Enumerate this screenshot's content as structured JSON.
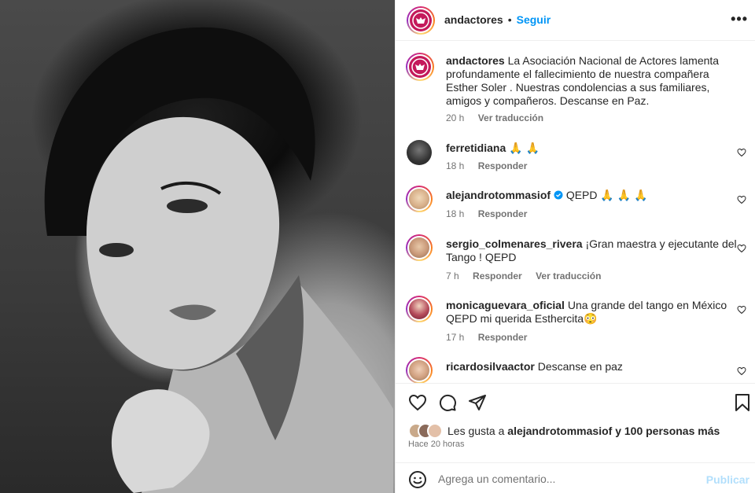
{
  "post": {
    "author": "andactores",
    "separator": "•",
    "follow_label": "Seguir",
    "more_label": "•••",
    "caption_user": "andactores",
    "caption_text": "La Asociación Nacional de Actores lamenta profundamente el fallecimiento de nuestra compañera Esther Soler . Nuestras condolencias a sus familiares, amigos y compañeros. Descanse en Paz.",
    "caption_time": "20 h",
    "caption_translate": "Ver traducción"
  },
  "comments": [
    {
      "user": "ferretidiana",
      "text": "🙏 🙏",
      "time": "18 h",
      "reply": "Responder",
      "verified": false
    },
    {
      "user": "alejandrotommasiof",
      "text": "QEPD 🙏 🙏 🙏",
      "time": "18 h",
      "reply": "Responder",
      "verified": true
    },
    {
      "user": "sergio_colmenares_rivera",
      "text": "¡Gran maestra y ejecutante del Tango ! QEPD",
      "time": "7 h",
      "reply": "Responder",
      "translate": "Ver traducción",
      "verified": false
    },
    {
      "user": "monicaguevara_oficial",
      "text": "Una grande del tango en México QEPD mi querida Esthercita😳",
      "time": "17 h",
      "reply": "Responder",
      "verified": false
    },
    {
      "user": "ricardosilvaactor",
      "text": "Descanse en paz",
      "verified": false
    }
  ],
  "likes": {
    "prefix": "Les gusta a",
    "user": "alejandrotommasiof",
    "suffix": "y 100 personas más",
    "time_ago": "Hace 20 horas"
  },
  "add_comment": {
    "placeholder": "Agrega un comentario...",
    "publish_label": "Publicar"
  },
  "colors": {
    "accent": "#0095f6",
    "brand": "#c4195b",
    "muted": "#737373"
  },
  "icons": [
    "heart-icon",
    "comment-icon",
    "share-icon",
    "bookmark-icon",
    "emoji-icon",
    "verified-icon"
  ]
}
